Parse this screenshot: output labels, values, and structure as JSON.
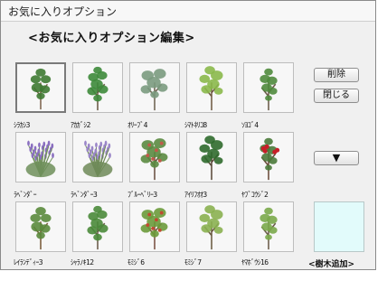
{
  "window": {
    "title": "お気に入りオプション"
  },
  "heading": "<お気に入りオプション編集>",
  "buttons": {
    "delete": "削除",
    "close": "閉じる",
    "scroll": "▼"
  },
  "add_tree": {
    "label": "<樹木追加>"
  },
  "items": [
    {
      "label": "ｼﾗｶｼ3",
      "selected": true,
      "foliage": "#3e7a32",
      "trunk": "#7a6048",
      "flowers": null
    },
    {
      "label": "ｱｶｶﾞｼ2",
      "selected": false,
      "foliage": "#3d8a3a",
      "trunk": "#6b5a45",
      "flowers": null
    },
    {
      "label": "ｵﾘｰﾌﾞ4",
      "selected": false,
      "foliage": "#7a9a7e",
      "trunk": "#6e6250",
      "flowers": null
    },
    {
      "label": "ｼﾏﾄﾈﾘｺ8",
      "selected": false,
      "foliage": "#8ab84a",
      "trunk": "#705a44",
      "flowers": null
    },
    {
      "label": "ｿﾖｺﾞ4",
      "selected": false,
      "foliage": "#4f8a3c",
      "trunk": "#6a5a48",
      "flowers": null
    },
    {
      "label": "ﾗﾍﾞﾝﾀﾞｰ",
      "selected": false,
      "foliage": "#6f8f5a",
      "trunk": "#6f8f5a",
      "flowers": "#8a6fc0"
    },
    {
      "label": "ﾗﾍﾞﾝﾀﾞｰ3",
      "selected": false,
      "foliage": "#6f8a58",
      "trunk": "#6f8a58",
      "flowers": "#9a86c8"
    },
    {
      "label": "ﾌﾞﾙｰﾍﾞﾘｰ3",
      "selected": false,
      "foliage": "#5a8a40",
      "trunk": "#6a5040",
      "flowers": "#c05a4a"
    },
    {
      "label": "ｱｲﾘﾌｵｵ3",
      "selected": false,
      "foliage": "#2f6a2c",
      "trunk": "#5a4a3a",
      "flowers": null
    },
    {
      "label": "ﾔﾌﾞｺｳｼﾞ2",
      "selected": false,
      "foliage": "#4a7a3a",
      "trunk": "#6a4a3a",
      "flowers": "#c81e28"
    },
    {
      "label": "ﾚｲﾗﾝﾃﾞｨｰ3",
      "selected": false,
      "foliage": "#5a8a3c",
      "trunk": "#7a5a3a",
      "flowers": null
    },
    {
      "label": "ｼｬﾗﾉｷ12",
      "selected": false,
      "foliage": "#4a8a3a",
      "trunk": "#6a5a48",
      "flowers": null
    },
    {
      "label": "ﾓﾐｼﾞ6",
      "selected": false,
      "foliage": "#6a9a3a",
      "trunk": "#7a5040",
      "flowers": "#c04a30"
    },
    {
      "label": "ﾓﾐｼﾞ7",
      "selected": false,
      "foliage": "#8ab050",
      "trunk": "#6a5a40",
      "flowers": null
    },
    {
      "label": "ﾔﾏﾎﾞｳｼ16",
      "selected": false,
      "foliage": "#7aa84a",
      "trunk": "#6a5a48",
      "flowers": null
    }
  ]
}
